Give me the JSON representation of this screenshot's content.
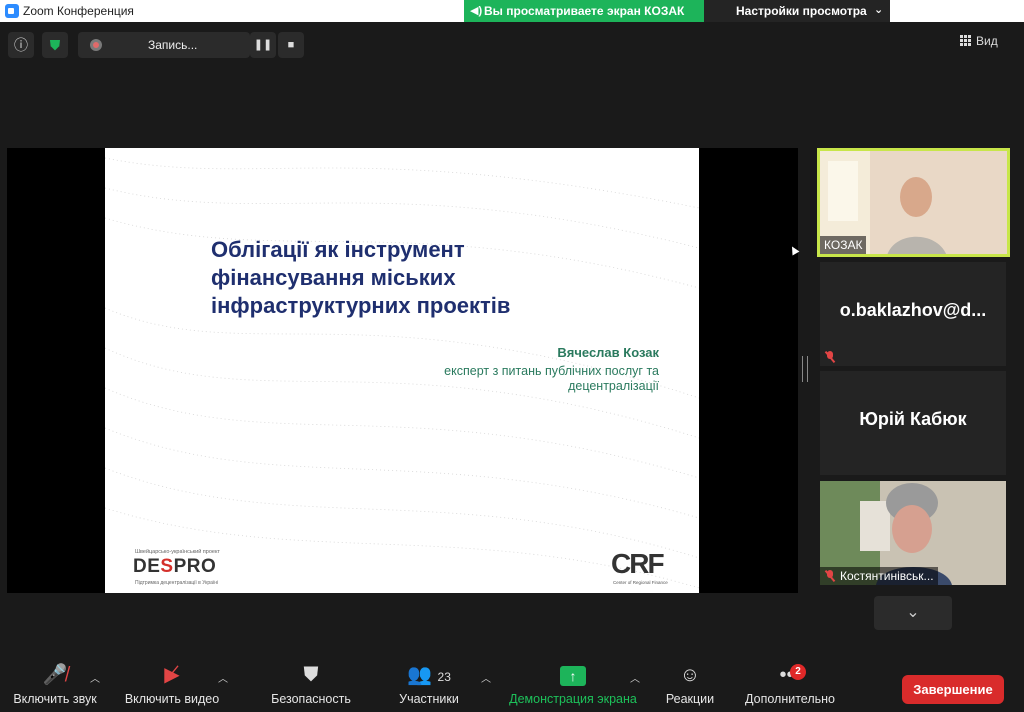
{
  "window": {
    "title": "Zoom Конференция"
  },
  "banner": {
    "viewing_text": "Вы просматриваете экран КОЗАК",
    "view_options": "Настройки просмотра"
  },
  "topbar": {
    "recording_label": "Запись...",
    "view_label": "Вид"
  },
  "slide": {
    "title_lines": [
      "Облігації як інструмент",
      "фінансування міських",
      "інфраструктурних проектів"
    ],
    "author": "Вячеслав Козак",
    "role_lines": [
      "експерт з питань публічних послуг та",
      "децентралізації"
    ],
    "despro_top": "Швейцарсько-український проект",
    "despro_logo_a": "DE",
    "despro_logo_s": "S",
    "despro_logo_b": "PRO",
    "despro_bottom": "Підтримка децентралізації в Україні",
    "crf_logo": "CRF",
    "crf_sub": "Center of Regional Finance"
  },
  "gallery": {
    "tiles": [
      {
        "name": "КОЗАК",
        "type": "video",
        "active": true
      },
      {
        "name": "o.baklazhov@d...",
        "type": "name",
        "muted": true
      },
      {
        "name": "Юрій Кабюк",
        "type": "name",
        "muted": false
      },
      {
        "name": "Костянтинівськ...",
        "type": "video",
        "muted": true
      }
    ]
  },
  "toolbar": {
    "audio": "Включить звук",
    "video": "Включить видео",
    "security": "Безопасность",
    "participants": "Участники",
    "participants_count": "23",
    "share": "Демонстрация экрана",
    "reactions": "Реакции",
    "more": "Дополнительно",
    "more_badge": "2",
    "end": "Завершение"
  },
  "colors": {
    "accent_green": "#1db45a",
    "active_border": "#c8e64a",
    "end_red": "#d92b2b",
    "slide_title": "#1f2f6f",
    "slide_text": "#2a7a5e"
  }
}
